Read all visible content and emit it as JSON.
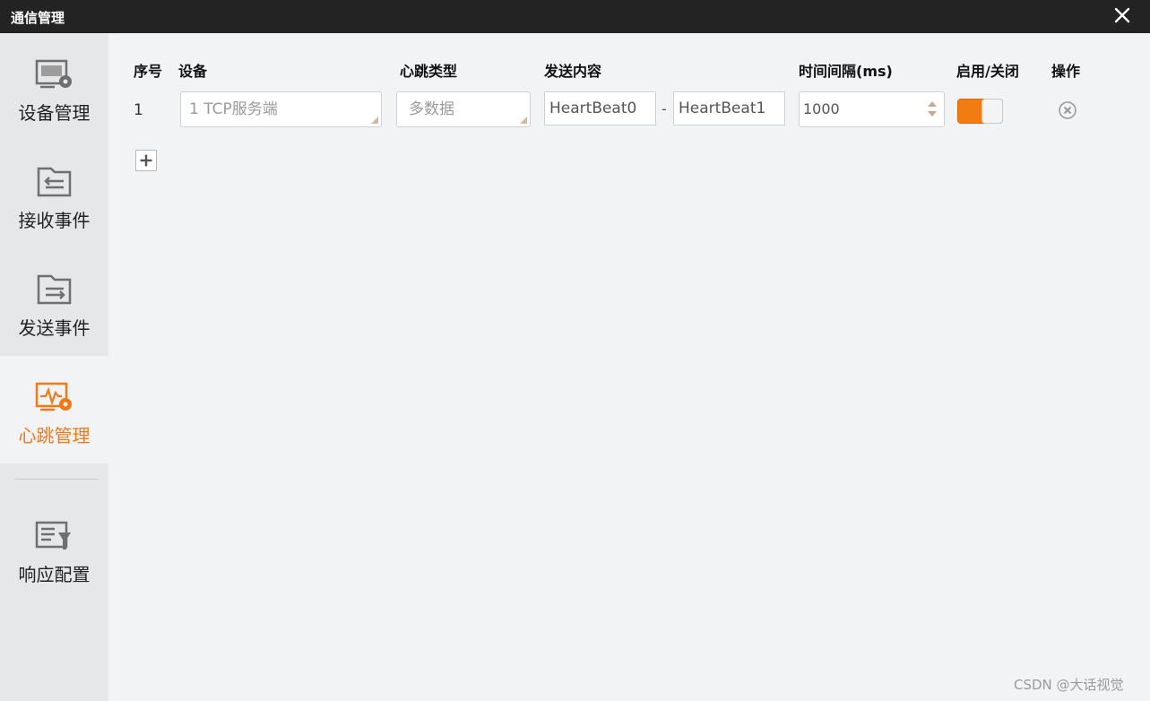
{
  "window": {
    "title": "通信管理"
  },
  "sidebar": {
    "items": [
      {
        "label": "设备管理",
        "icon": "device-settings-icon"
      },
      {
        "label": "接收事件",
        "icon": "receive-event-icon"
      },
      {
        "label": "发送事件",
        "icon": "send-event-icon"
      },
      {
        "label": "心跳管理",
        "icon": "heartbeat-settings-icon"
      },
      {
        "label": "响应配置",
        "icon": "response-config-icon"
      }
    ],
    "active_index": 3
  },
  "table": {
    "headers": [
      "序号",
      "设备",
      "心跳类型",
      "发送内容",
      "时间间隔(ms)",
      "启用/关闭",
      "操作"
    ],
    "rows": [
      {
        "index": "1",
        "device": "1 TCP服务端",
        "heartbeat_type": "多数据",
        "content_start": "HeartBeat0",
        "content_separator": "-",
        "content_end": "HeartBeat1",
        "interval": "1000",
        "enabled": true
      }
    ]
  },
  "colors": {
    "accent": "#f07a18",
    "titlebar": "#232323",
    "background": "#f2f3f5",
    "sidebar": "#e6e7e9"
  },
  "watermark": "CSDN @大话视觉"
}
